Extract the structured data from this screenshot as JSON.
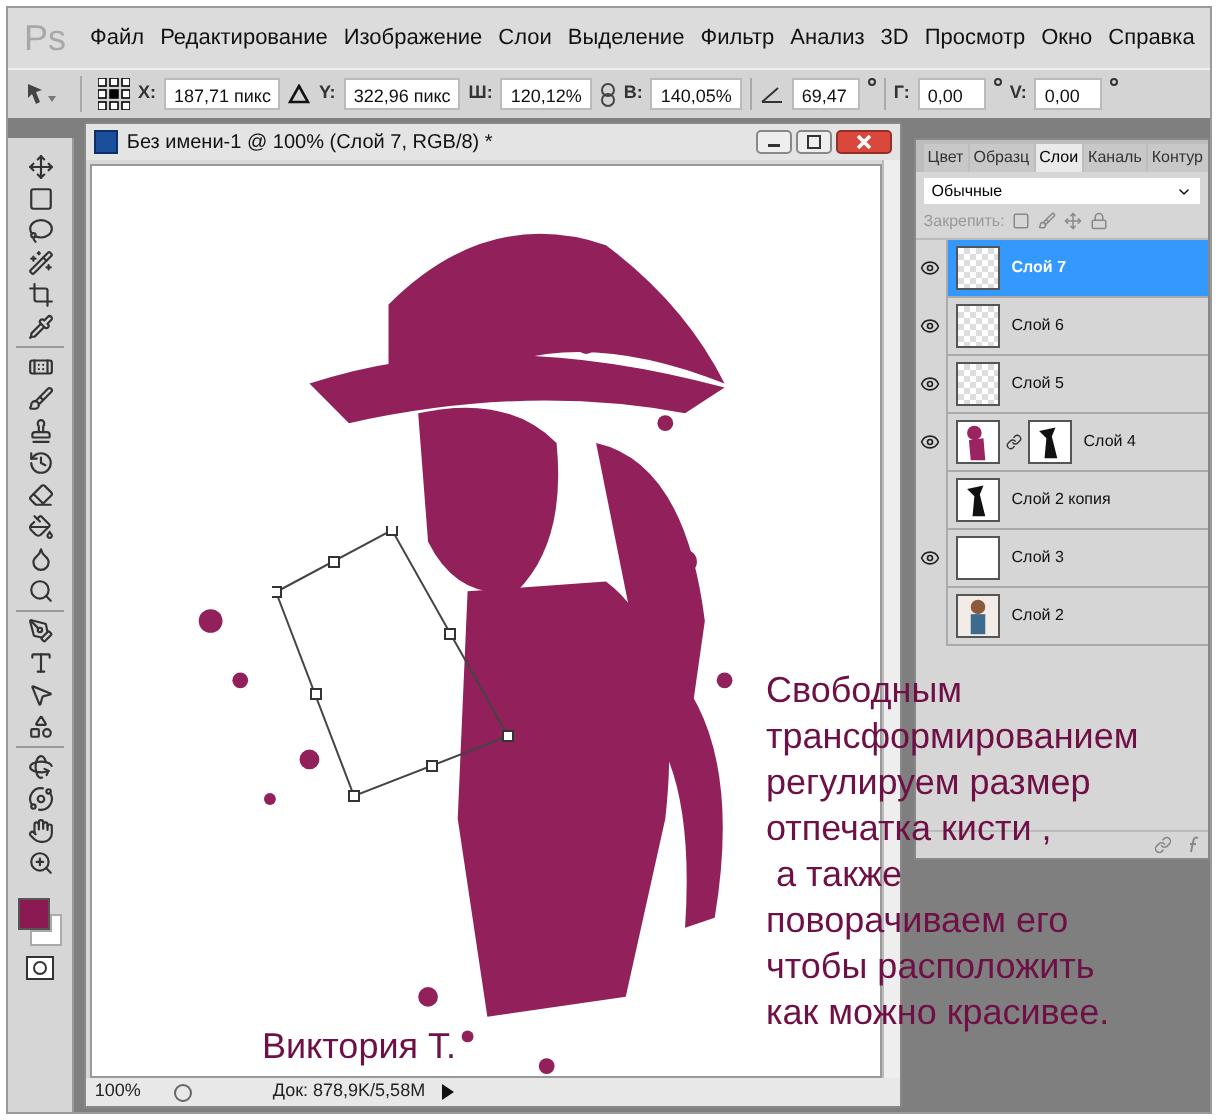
{
  "app_logo": "Ps",
  "menu": [
    "Файл",
    "Редактирование",
    "Изображение",
    "Слои",
    "Выделение",
    "Фильтр",
    "Анализ",
    "3D",
    "Просмотр",
    "Окно",
    "Справка"
  ],
  "options": [
    {
      "label": "X:",
      "value": "187,71 пикс"
    },
    {
      "label": "Y:",
      "value": "322,96 пикс"
    },
    {
      "label": "Ш:",
      "value": "120,12%"
    },
    {
      "label": "В:",
      "value": "140,05%"
    },
    {
      "value": "69,47"
    },
    {
      "label": "Г:",
      "value": "0,00"
    },
    {
      "label": "V:",
      "value": "0,00"
    }
  ],
  "document": {
    "title": "Без имени-1 @ 100% (Слой 7, RGB/8) *",
    "zoom": "100%",
    "doc_info": "Док: 878,9K/5,58M"
  },
  "layers_panel": {
    "tabs": [
      {
        "label": "Цвет",
        "selected": false
      },
      {
        "label": "Образц",
        "selected": false
      },
      {
        "label": "Слои",
        "selected": true
      },
      {
        "label": "Каналь",
        "selected": false
      },
      {
        "label": "Контур",
        "selected": false
      }
    ],
    "blend_mode": "Обычные",
    "lock_label": "Закрепить:",
    "layers": [
      {
        "name": "Слой 7",
        "visible": true,
        "selected": true,
        "kind": "transparent",
        "mask": false
      },
      {
        "name": "Слой 6",
        "visible": true,
        "selected": false,
        "kind": "transparent",
        "mask": false
      },
      {
        "name": "Слой 5",
        "visible": true,
        "selected": false,
        "kind": "transparent",
        "mask": false
      },
      {
        "name": "Слой 4",
        "visible": true,
        "selected": false,
        "kind": "art",
        "mask": true
      },
      {
        "name": "Слой 2 копия",
        "visible": false,
        "selected": false,
        "kind": "silhouette",
        "mask": false
      },
      {
        "name": "Слой 3",
        "visible": true,
        "selected": false,
        "kind": "white",
        "mask": false
      },
      {
        "name": "Слой 2",
        "visible": false,
        "selected": false,
        "mask": false
      }
    ]
  },
  "annotation": [
    "Свободным",
    "трансформированием",
    "регулируем размер",
    "отпечатка кисти ,",
    " а также",
    "поворачиваем его",
    "чтобы расположить",
    "как можно красивее."
  ],
  "signature": "Виктория Т."
}
